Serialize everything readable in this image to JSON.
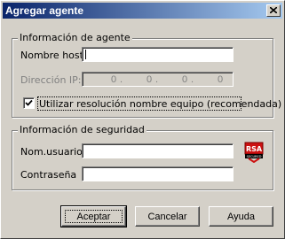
{
  "window": {
    "title": "Agregar agente",
    "close_symbol": "close-icon"
  },
  "agent_group": {
    "label": "Información de agente",
    "hostname_label": "Nombre host:",
    "hostname_value": "",
    "ip_label": "Dirección IP:",
    "ip_octets": [
      "0",
      "0",
      "0",
      "0"
    ],
    "use_resolution_label": "Utilizar resolución nombre equipo (recomendada)",
    "use_resolution_checked": true
  },
  "security_group": {
    "label": "Información de seguridad",
    "username_label": "Nom.usuario:",
    "username_value": "",
    "password_label": "Contraseña",
    "password_value": "",
    "logo_text": "RSA",
    "logo_subtext": "SECURED"
  },
  "buttons": {
    "accept": "Aceptar",
    "cancel": "Cancelar",
    "help": "Ayuda"
  },
  "colors": {
    "titlebar_start": "#0a246a",
    "titlebar_end": "#a6caf0",
    "dialog_bg": "#d4d0c8",
    "rsa_red": "#cc1111"
  }
}
